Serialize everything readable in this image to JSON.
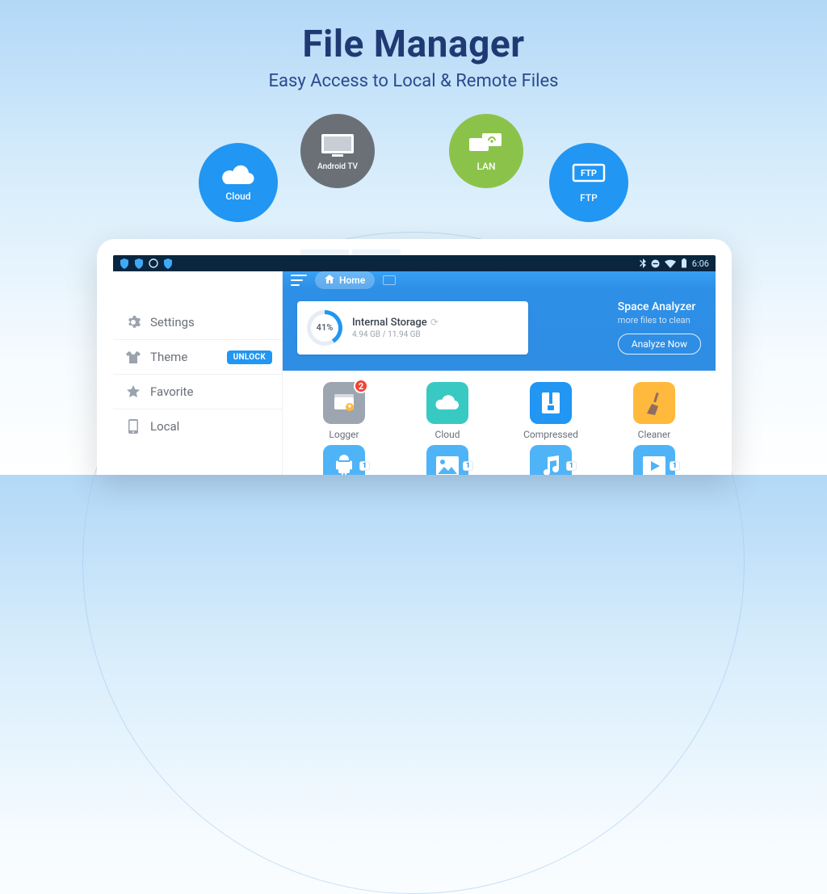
{
  "hero": {
    "title": "File Manager",
    "subtitle": "Easy Access to Local & Remote Files"
  },
  "bubbles": {
    "cloud": "Cloud",
    "tv": "Android TV",
    "lan": "LAN",
    "ftp": "FTP"
  },
  "statusbar": {
    "time": "6:06"
  },
  "sidebar": {
    "settings": "Settings",
    "theme": "Theme",
    "unlock": "UNLOCK",
    "favorite": "Favorite",
    "local": "Local"
  },
  "topbar": {
    "home": "Home"
  },
  "storage": {
    "percent": "41%",
    "title": "Internal Storage",
    "detail": "4.94 GB / 11.94 GB"
  },
  "analyzer": {
    "title": "Space Analyzer",
    "sub": "more files to clean",
    "button": "Analyze Now"
  },
  "tiles": {
    "logger": {
      "label": "Logger",
      "badge": "2"
    },
    "cloud": {
      "label": "Cloud"
    },
    "compressed": {
      "label": "Compressed"
    },
    "cleaner": {
      "label": "Cleaner"
    },
    "row2badge": "1"
  }
}
